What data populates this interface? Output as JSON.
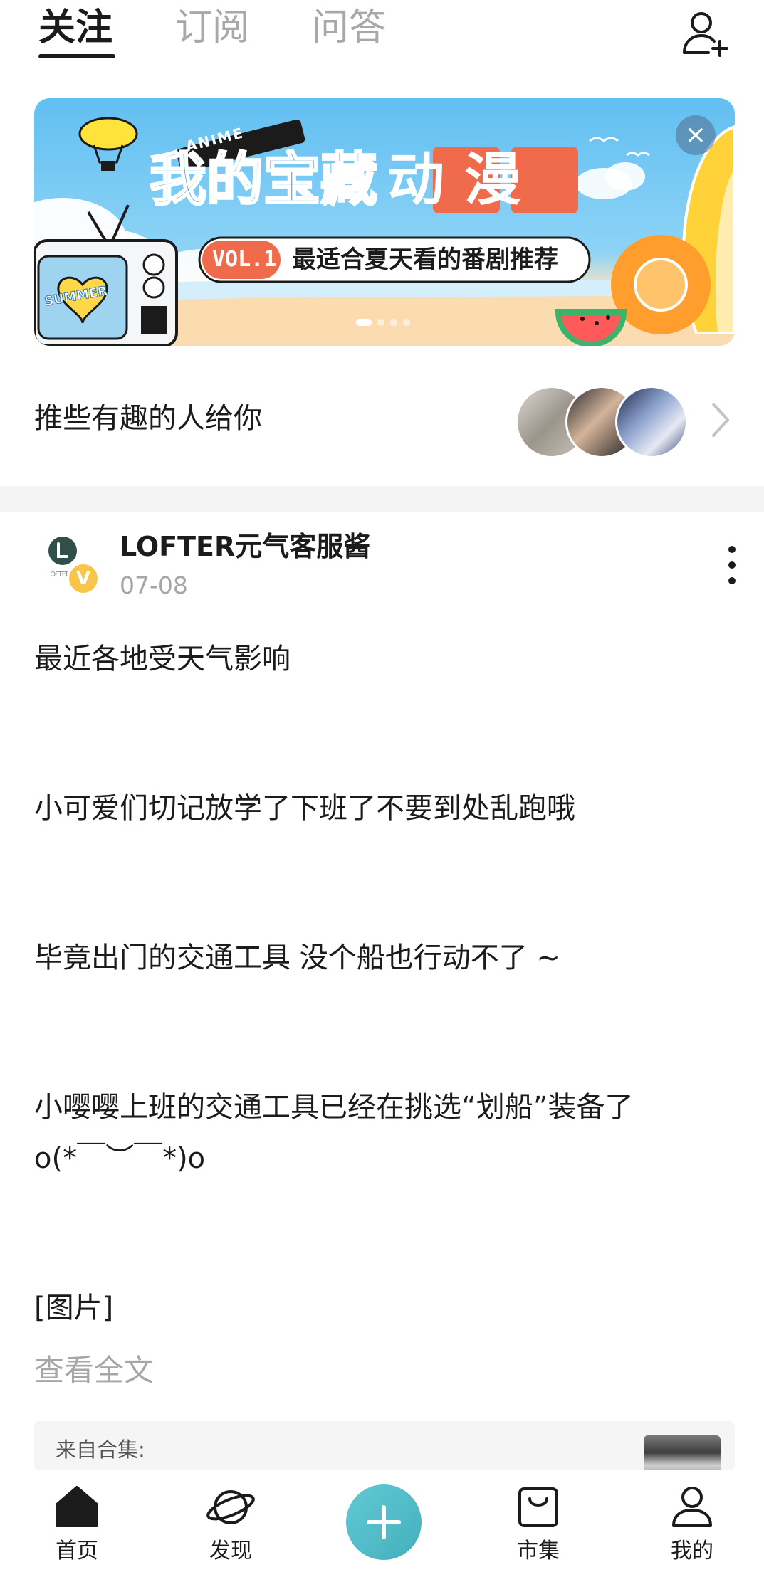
{
  "tabs": [
    {
      "label": "关注",
      "active": true
    },
    {
      "label": "订阅",
      "active": false
    },
    {
      "label": "问答",
      "active": false
    }
  ],
  "banner": {
    "badge": "ANIME",
    "title_part1": "我的宝藏",
    "title_part2": "动",
    "title_part3": "漫",
    "vol": "VOL.1",
    "subtitle": "最适合夏天看的番剧推荐",
    "tv_sign": "SUMMER",
    "close_label": "×"
  },
  "recommend": {
    "text": "推些有趣的人给你"
  },
  "post": {
    "author": "LOFTER元气客服酱",
    "date": "07-08",
    "avatar_letter": "L",
    "avatar_small_text": "LOFTER",
    "verified_badge": "V",
    "lines": [
      "最近各地受天气影响",
      "小可爱们切记放学了下班了不要到处乱跑哦",
      "毕竟出门的交通工具 没个船也行动不了 ~",
      "小嘤嘤上班的交通工具已经在挑选“划船”装备了",
      "o(*￣︶￣*)o",
      "[图片]"
    ],
    "read_more": "查看全文",
    "collection_label": "来自合集:"
  },
  "bottom_nav": [
    {
      "label": "首页",
      "icon": "home-icon",
      "active": true
    },
    {
      "label": "发现",
      "icon": "planet-icon",
      "active": false
    },
    {
      "label": "",
      "icon": "plus-icon",
      "active": false
    },
    {
      "label": "市集",
      "icon": "shopping-bag-icon",
      "active": false
    },
    {
      "label": "我的",
      "icon": "person-icon",
      "active": false
    }
  ],
  "colors": {
    "accent": "#4dbac6",
    "text": "#1b1b1b",
    "muted": "#a6a6a6",
    "banner_orange": "#ef6b4c"
  }
}
